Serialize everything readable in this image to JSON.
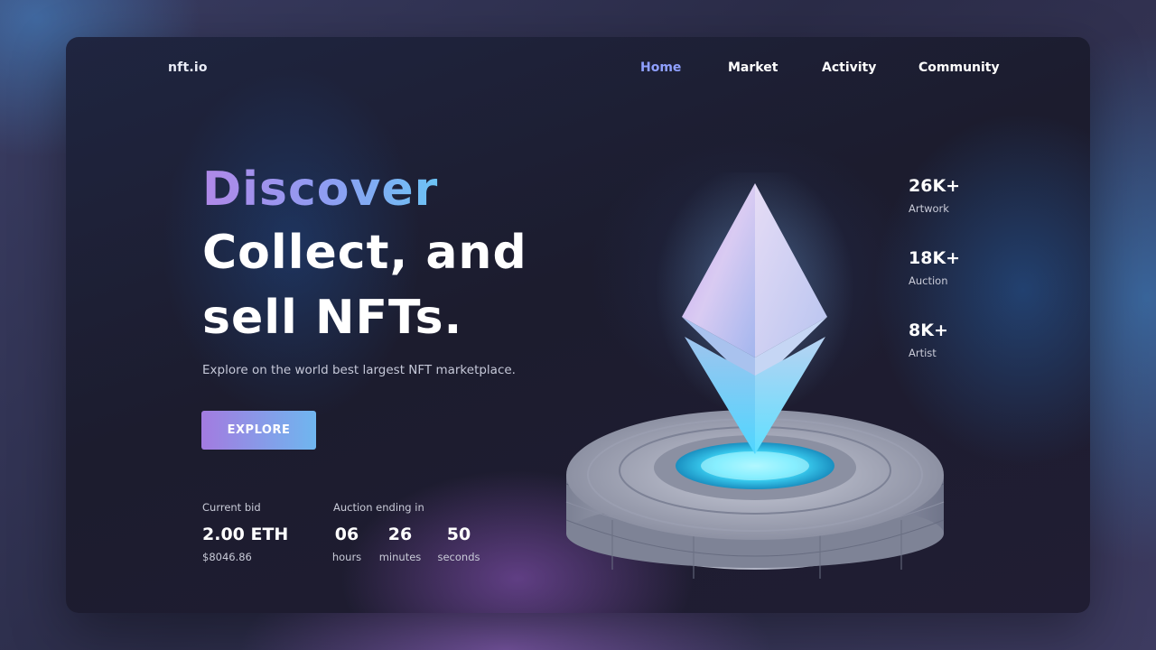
{
  "brand": {
    "logo_text": "nft.io"
  },
  "nav": {
    "items": [
      {
        "label": "Home",
        "active": true
      },
      {
        "label": "Market",
        "active": false
      },
      {
        "label": "Activity",
        "active": false
      },
      {
        "label": "Community",
        "active": false
      }
    ]
  },
  "hero": {
    "line1": "Discover",
    "line2": "Collect, and",
    "line3": "sell NFTs.",
    "subtitle": "Explore on the world best largest NFT marketplace.",
    "cta_label": "EXPLORE"
  },
  "bid": {
    "label": "Current bid",
    "value": "2.00 ETH",
    "usd": "$8046.86"
  },
  "auction": {
    "label": "Auction ending in",
    "hours": "06",
    "hours_label": "hours",
    "minutes": "26",
    "minutes_label": "minutes",
    "seconds": "50",
    "seconds_label": "seconds"
  },
  "stats": [
    {
      "value": "26K+",
      "label": "Artwork"
    },
    {
      "value": "18K+",
      "label": "Auction"
    },
    {
      "value": "8K+",
      "label": "Artist"
    }
  ],
  "artwork": {
    "icon": "ethereum-icon",
    "pedestal": "glowing-pedestal"
  },
  "colors": {
    "accent_purple": "#a37be0",
    "accent_blue": "#6fb6ef",
    "nav_active": "#8fa0ff",
    "card_bg": "#1c1c2e",
    "glow_cyan": "#44e0ff"
  }
}
